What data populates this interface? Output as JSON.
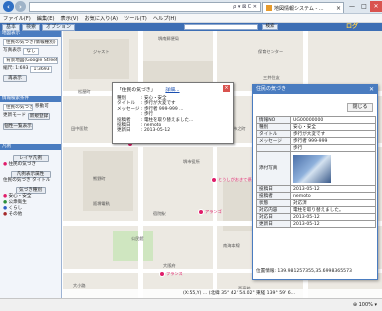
{
  "browser": {
    "address_tail": "ρ ▾ ⊠ C ✕",
    "tab_title": "地図情報システム - ...",
    "tab_close": "×",
    "window_controls": [
      "—",
      "□",
      "✕"
    ],
    "menu": [
      "ファイル(F)",
      "編集(E)",
      "表示(V)",
      "お気に入り(A)",
      "ツール(T)",
      "ヘルプ(H)"
    ]
  },
  "app": {
    "tabs": [
      "基本",
      "検索",
      "オプション"
    ],
    "search_button": "検索",
    "logo": "ログ"
  },
  "sidebar": {
    "panel1_title": "地図表示",
    "layer_select": "住民の気づき(情報種別)",
    "photo_label": "写真表示",
    "photo_value": "なし",
    "map_label": "背景地図(Google Street)",
    "scale_label": "縮尺: 1:693",
    "scale_value": "1:3693",
    "redraw_button": "再表示",
    "panel2_title": "情報検索条件",
    "query_select": "住民の気づき",
    "can_move": "移動可",
    "update_mode": "更新モード",
    "new_register": "新規登録",
    "list_button": "個性一覧表示",
    "panel3_title": "凡例",
    "legend_button": "レイヤ凡例",
    "legend_item1": "住民の気づき",
    "display_attr_button": "凡例表示属性",
    "attr_item": "住民の気づき タイトル",
    "type_title": "気づき種別",
    "types": [
      {
        "label": "安心・安全",
        "color": "#e01d6a"
      },
      {
        "label": "公衆衛生",
        "color": "#2a8f3a"
      },
      {
        "label": "くらし",
        "color": "#2f5fc4"
      },
      {
        "label": "その他",
        "color": "#a52a2a"
      }
    ]
  },
  "map": {
    "labels": [
      "ジャスト",
      "堺南郵便局",
      "保育センター",
      "田中医院",
      "堺市役所",
      "阪堺電軌",
      "南海本線",
      "大阪府",
      "三井住友",
      "松屋町",
      "市之町",
      "熊野町",
      "宿院駅",
      "公民館",
      "西高校",
      "大小路",
      "綾之町",
      "北花田口"
    ],
    "pin_label": "とうしがおきて停止中",
    "pin2_label": "アランゴ",
    "pin3_label": "フランス"
  },
  "popup": {
    "title": "「住民の気づき」",
    "detail_link": "詳細...",
    "close": "×",
    "rows": [
      {
        "k": "種別",
        "v": ": 安心・安全"
      },
      {
        "k": "タイトル",
        "v": ": 歩行が大変です"
      },
      {
        "k": "メッセージ",
        "v": ": 歩行者 999-999 ..."
      },
      {
        "k": "",
        "v": ": 歩行"
      },
      {
        "k": "投稿者",
        "v": ": 電柱を取り替えました..."
      },
      {
        "k": "投稿日",
        "v": ": nemoto"
      },
      {
        "k": "更新日",
        "v": ": 2013-05-12"
      }
    ]
  },
  "detail": {
    "title": "住民の気づき",
    "close": "✕",
    "back_button": "閉じる",
    "rows": [
      {
        "k": "情報NO",
        "v": "UG00000000"
      },
      {
        "k": "種別",
        "v": "安心・安全"
      },
      {
        "k": "タイトル",
        "v": "歩行が大変です"
      },
      {
        "k": "メッセージ",
        "v": "歩行者 999-999"
      },
      {
        "k": "",
        "v": "歩行"
      }
    ],
    "photo_label": "添付写真",
    "rows2": [
      {
        "k": "投稿日",
        "v": "2013-05-12"
      },
      {
        "k": "投稿者",
        "v": "nemoto"
      },
      {
        "k": "状態",
        "v": "対応済"
      },
      {
        "k": "対応内容",
        "v": "電柱を取り替えました。"
      },
      {
        "k": "対応日",
        "v": "2013-05-12"
      },
      {
        "k": "更新日",
        "v": "2013-05-12"
      }
    ],
    "coords": "位置情報: 139.981257355,35.6998365573"
  },
  "status": {
    "coord_line": "(X:55,Y) ... (北緯 35° 42' 54.02\" 東経 139° 59' 6...",
    "zoom": "⊕ 100% ▾"
  }
}
